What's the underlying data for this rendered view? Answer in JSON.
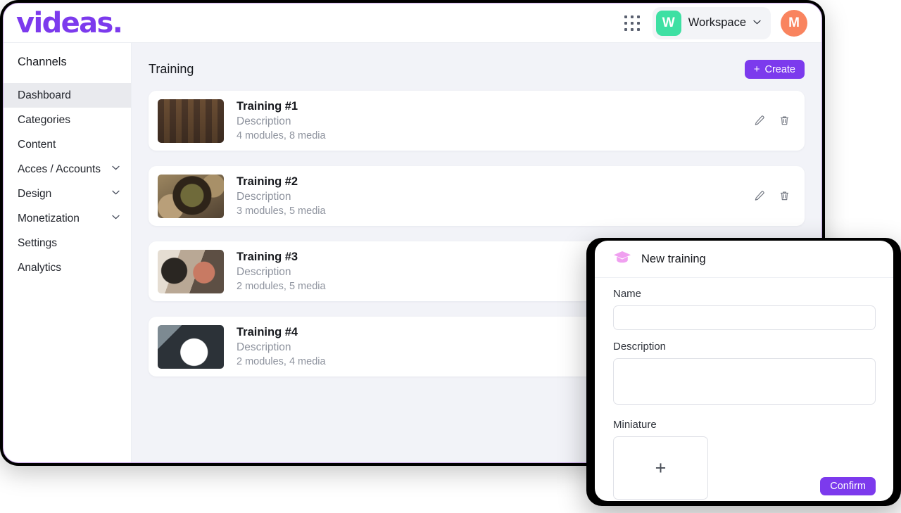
{
  "header": {
    "brand": "videas.",
    "apps_icon": "apps-grid-icon",
    "workspace": {
      "initial": "W",
      "label": "Workspace",
      "caret_icon": "chevron-down-icon",
      "badge_color": "#3ee0a3"
    },
    "avatar": {
      "initial": "M",
      "color": "#f9845f"
    }
  },
  "sidebar": {
    "title": "Channels",
    "items": [
      {
        "label": "Dashboard",
        "active": true,
        "expandable": false
      },
      {
        "label": "Categories",
        "active": false,
        "expandable": false
      },
      {
        "label": "Content",
        "active": false,
        "expandable": false
      },
      {
        "label": "Acces / Accounts",
        "active": false,
        "expandable": true
      },
      {
        "label": "Design",
        "active": false,
        "expandable": true
      },
      {
        "label": "Monetization",
        "active": false,
        "expandable": true
      },
      {
        "label": "Settings",
        "active": false,
        "expandable": false
      },
      {
        "label": "Analytics",
        "active": false,
        "expandable": false
      }
    ]
  },
  "main": {
    "page_title": "Training",
    "create_button": {
      "label": "Create",
      "plus": "+",
      "color": "#7c3aed"
    },
    "cards": [
      {
        "title": "Training #1",
        "description": "Description",
        "meta": "4 modules, 8 media",
        "thumbnail": "coffee-shop-shelves-photo",
        "edit_icon": "pencil-icon",
        "delete_icon": "trash-icon"
      },
      {
        "title": "Training #2",
        "description": "Description",
        "meta": "3 modules, 5 media",
        "thumbnail": "coffee-beans-bowl-photo",
        "edit_icon": "pencil-icon",
        "delete_icon": "trash-icon"
      },
      {
        "title": "Training #3",
        "description": "Description",
        "meta": "2 modules, 5 media",
        "thumbnail": "barista-customer-photo",
        "edit_icon": "pencil-icon",
        "delete_icon": "trash-icon"
      },
      {
        "title": "Training #4",
        "description": "Description",
        "meta": "2 modules, 4 media",
        "thumbnail": "latte-art-cup-photo",
        "edit_icon": "pencil-icon",
        "delete_icon": "trash-icon"
      }
    ]
  },
  "modal": {
    "icon": "graduation-cap-icon",
    "icon_color": "#f0a0f0",
    "title": "New training",
    "name_label": "Name",
    "name_value": "",
    "name_placeholder": "",
    "description_label": "Description",
    "description_value": "",
    "description_placeholder": "",
    "miniature_label": "Miniature",
    "miniature_plus": "+",
    "confirm_label": "Confirm",
    "confirm_color": "#7c3aed"
  }
}
